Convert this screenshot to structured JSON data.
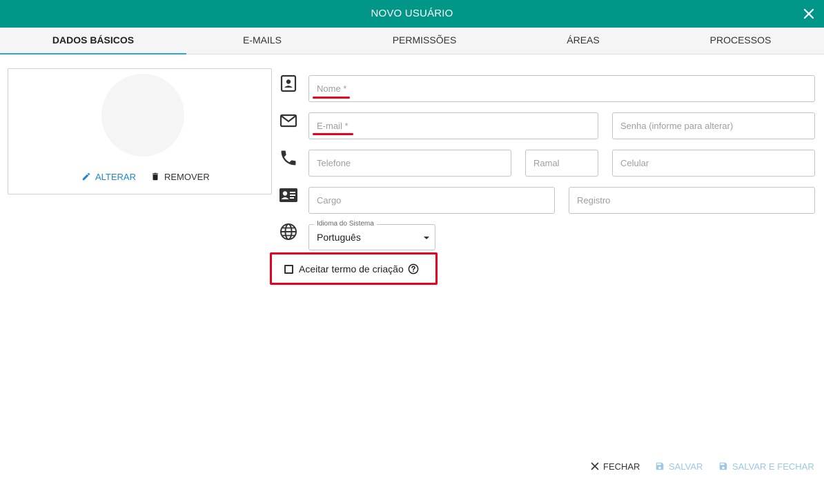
{
  "dialog": {
    "title": "NOVO USUÁRIO"
  },
  "tabs": [
    {
      "label": "DADOS BÁSICOS",
      "active": true
    },
    {
      "label": "E-MAILS",
      "active": false
    },
    {
      "label": "PERMISSÕES",
      "active": false
    },
    {
      "label": "ÁREAS",
      "active": false
    },
    {
      "label": "PROCESSOS",
      "active": false
    }
  ],
  "photo": {
    "alter_label": "ALTERAR",
    "remove_label": "REMOVER"
  },
  "fields": {
    "nome": {
      "placeholder": "Nome *",
      "value": ""
    },
    "email": {
      "placeholder": "E-mail *",
      "value": ""
    },
    "senha": {
      "placeholder": "Senha (informe para alterar)",
      "value": ""
    },
    "telefone": {
      "placeholder": "Telefone",
      "value": ""
    },
    "ramal": {
      "placeholder": "Ramal",
      "value": ""
    },
    "celular": {
      "placeholder": "Celular",
      "value": ""
    },
    "cargo": {
      "placeholder": "Cargo",
      "value": ""
    },
    "registro": {
      "placeholder": "Registro",
      "value": ""
    }
  },
  "language": {
    "label": "Idioma do Sistema",
    "value": "Português"
  },
  "terms": {
    "label": "Aceitar termo de criação",
    "checked": false
  },
  "footer": {
    "close_label": "FECHAR",
    "save_label": "SALVAR",
    "save_close_label": "SALVAR E FECHAR"
  },
  "colors": {
    "header": "#009688",
    "tab_indicator": "#29a8d8",
    "accent": "#1e88c8",
    "annotation": "#e8001c",
    "disabled": "#9cc7e6"
  },
  "icons": [
    "close-icon",
    "pencil-icon",
    "trash-icon",
    "contact-card-icon",
    "mail-icon",
    "phone-icon",
    "id-card-icon",
    "globe-icon",
    "help-circle-icon",
    "save-icon"
  ]
}
